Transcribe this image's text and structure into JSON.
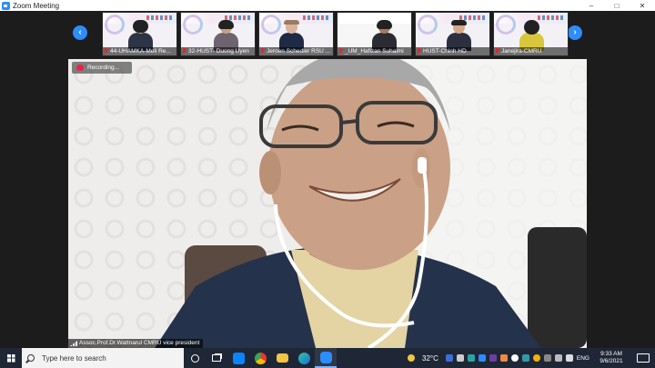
{
  "window": {
    "title": "Zoom Meeting",
    "controls": [
      "–",
      "□",
      "✕"
    ]
  },
  "gallery": {
    "prev_icon": "chevron-left-icon",
    "next_icon": "chevron-right-icon",
    "participants": [
      {
        "name": "44-UHAMKA-Meli Re...",
        "muted": true
      },
      {
        "name": "32-HUST- Duong Uyen",
        "muted": true
      },
      {
        "name": "Jeroen Schedler RSU ...",
        "muted": true
      },
      {
        "name": "_UM_Hafizan Suhaimi",
        "muted": true
      },
      {
        "name": "HUST-Chinh HD",
        "muted": true
      },
      {
        "name": "Janejira-CMRU",
        "muted": true
      }
    ]
  },
  "main_video": {
    "recording_label": "Recording...",
    "speaker_name": "Assoc.Prof.Dr.Wattnarul CMRU vice president"
  },
  "taskbar": {
    "search_placeholder": "Type here to search",
    "apps": [
      "cortana-icon",
      "task-view-icon",
      "zalo-icon",
      "chrome-icon",
      "file-explorer-icon",
      "edge-icon",
      "zoom-icon"
    ],
    "temperature": "32°C",
    "language": "ENG",
    "time": "9:33 AM",
    "date": "9/6/2021"
  },
  "colors": {
    "zoom_blue": "#2d8cff",
    "taskbar_bg": "#1f2736",
    "mute_red": "#e02828"
  }
}
